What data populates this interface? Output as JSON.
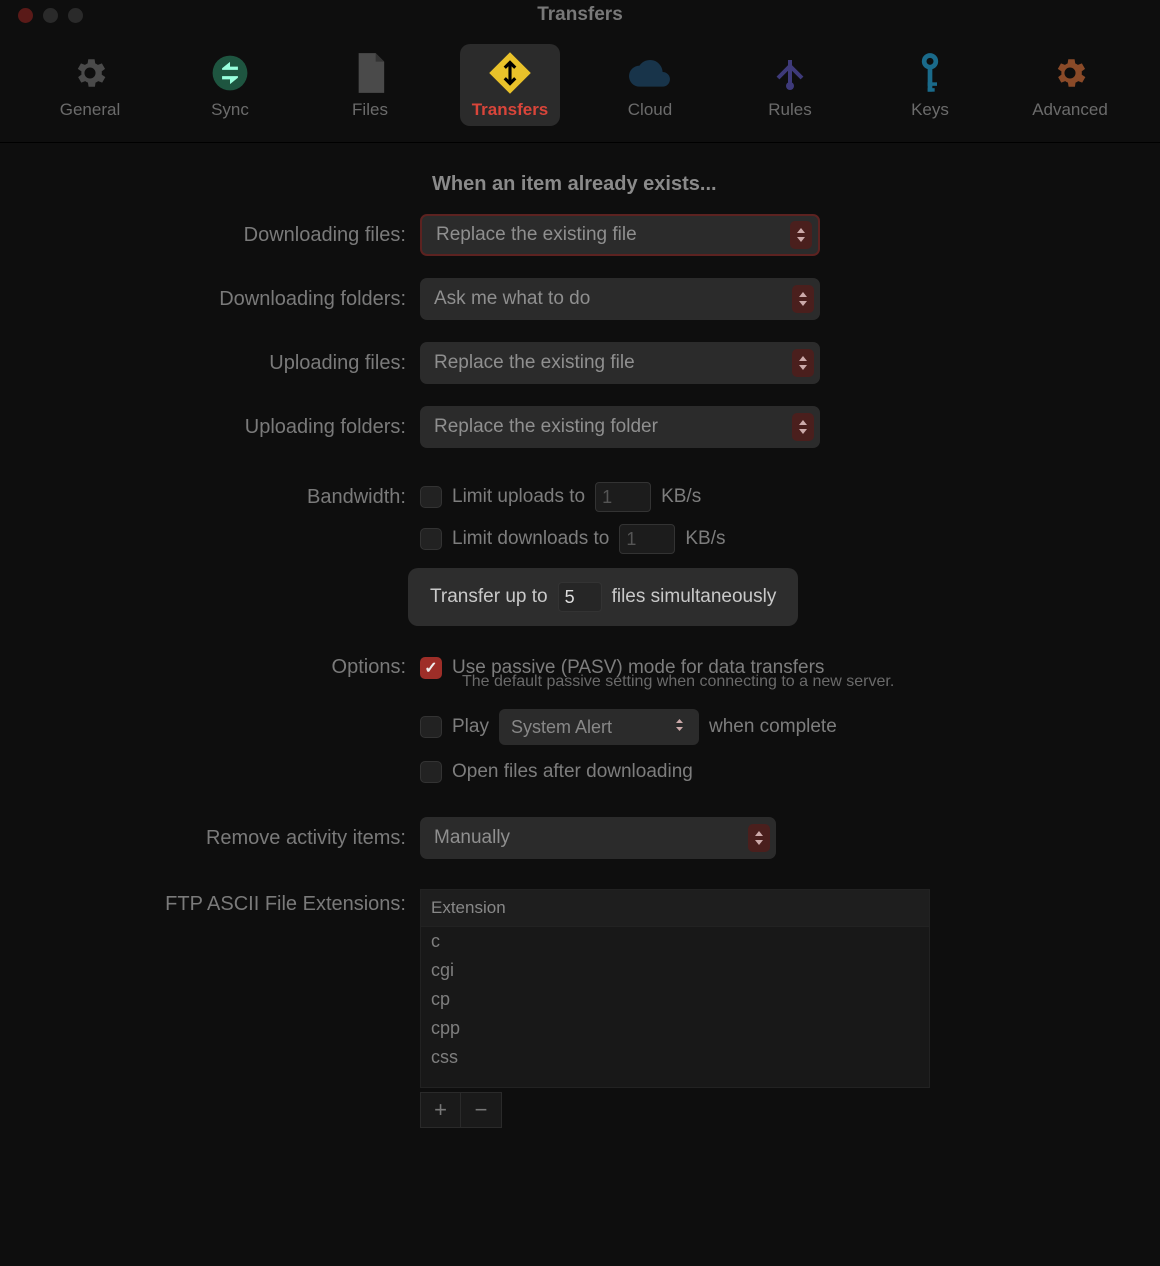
{
  "window": {
    "title": "Transfers"
  },
  "toolbar": {
    "items": [
      {
        "label": "General"
      },
      {
        "label": "Sync"
      },
      {
        "label": "Files"
      },
      {
        "label": "Transfers"
      },
      {
        "label": "Cloud"
      },
      {
        "label": "Rules"
      },
      {
        "label": "Keys"
      },
      {
        "label": "Advanced"
      }
    ]
  },
  "section_heading": "When an item already exists...",
  "rows": {
    "dl_files_label": "Downloading files:",
    "dl_files_value": "Replace the existing file",
    "dl_folders_label": "Downloading folders:",
    "dl_folders_value": "Ask me what to do",
    "ul_files_label": "Uploading files:",
    "ul_files_value": "Replace the existing file",
    "ul_folders_label": "Uploading folders:",
    "ul_folders_value": "Replace the existing folder",
    "bandwidth_label": "Bandwidth:",
    "limit_uploads": "Limit uploads to",
    "limit_downloads": "Limit downloads to",
    "kbps": "KB/s",
    "limit_up_val": "1",
    "limit_down_val": "1",
    "xfer_prefix": "Transfer up to",
    "xfer_count": "5",
    "xfer_suffix": "files simultaneously",
    "options_label": "Options:",
    "pasv": "Use passive (PASV) mode for data transfers",
    "pasv_note": "The default passive setting when connecting to a new server.",
    "play": "Play",
    "sound_value": "System Alert",
    "when_complete": "when complete",
    "open_after": "Open files after downloading",
    "remove_label": "Remove activity items:",
    "remove_value": "Manually",
    "ext_label": "FTP ASCII File Extensions:",
    "ext_header": "Extension",
    "exts": [
      "c",
      "cgi",
      "cp",
      "cpp",
      "css"
    ]
  }
}
